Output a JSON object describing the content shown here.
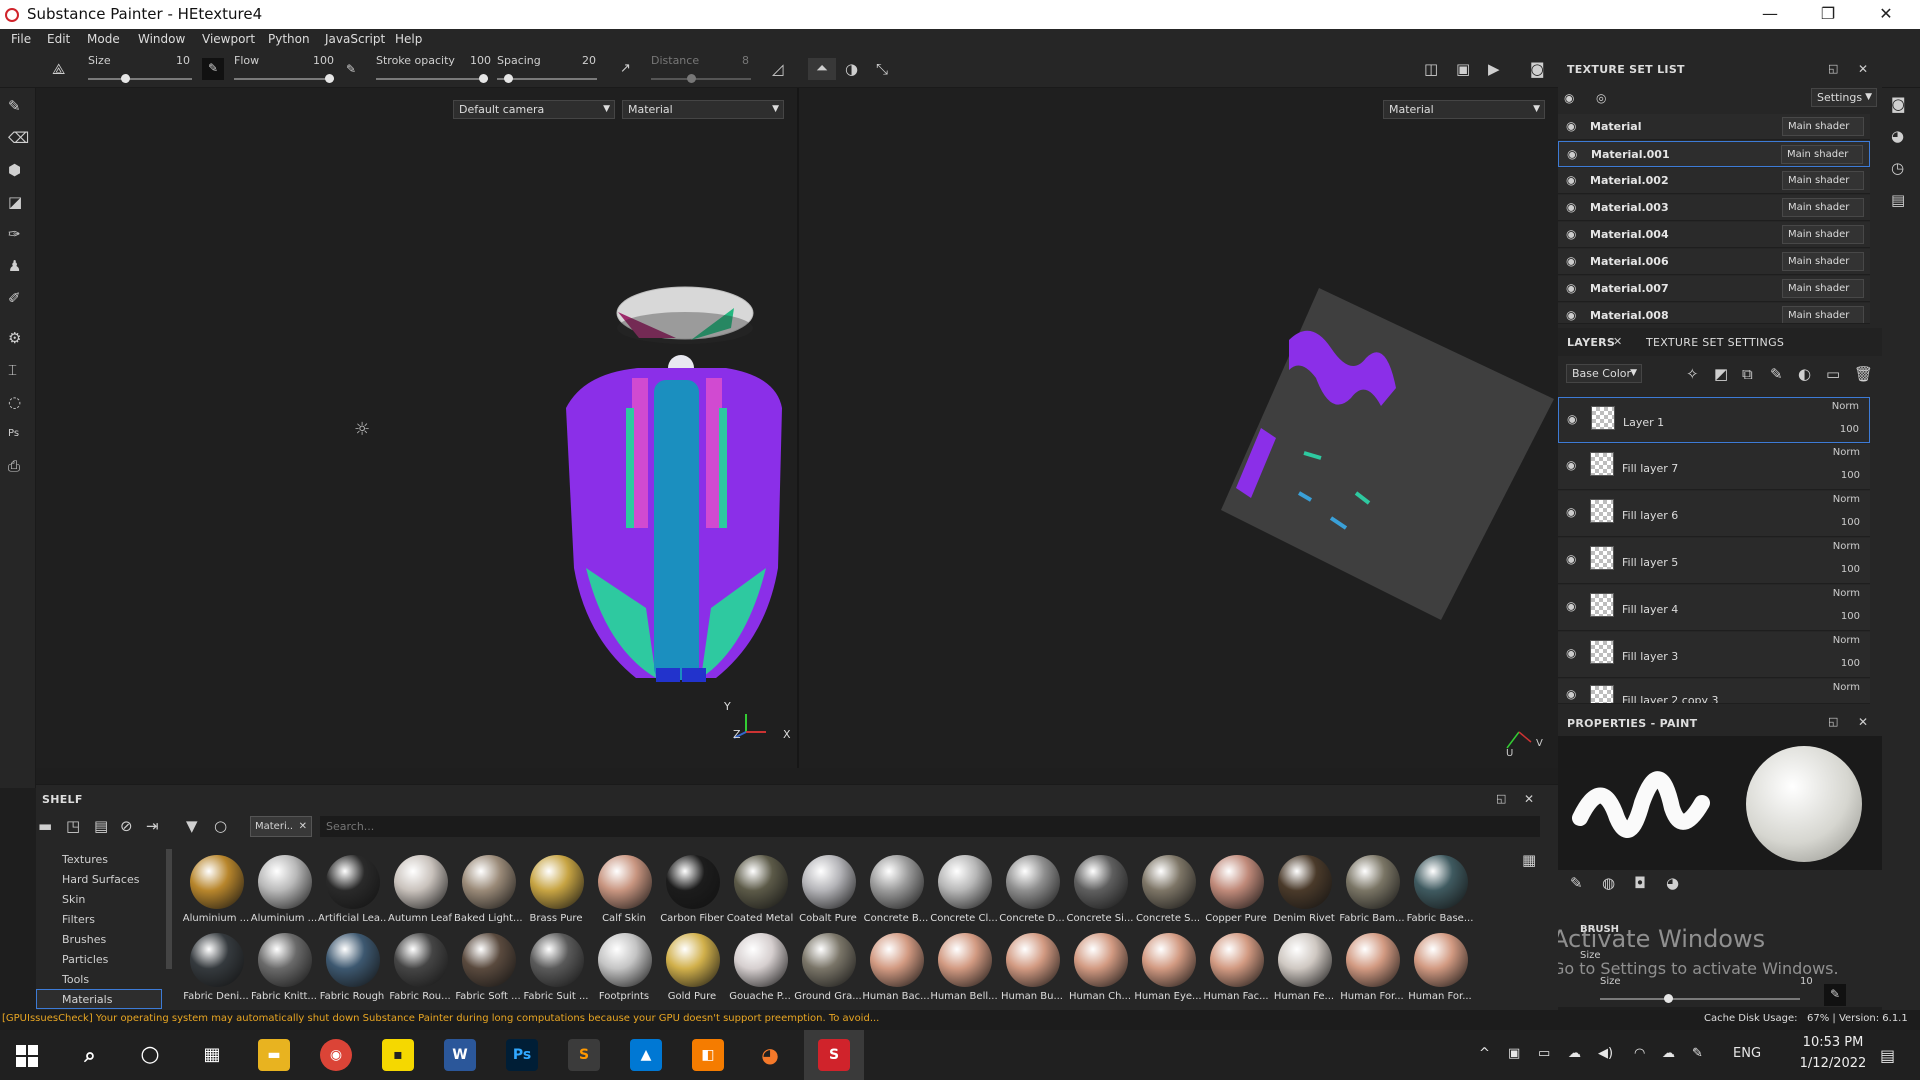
{
  "app": {
    "title": "Substance Painter - HEtexture4"
  },
  "window_controls": {
    "minimize": "—",
    "maximize": "❐",
    "close": "✕"
  },
  "menu": [
    "File",
    "Edit",
    "Mode",
    "Window",
    "Viewport",
    "Python",
    "JavaScript",
    "Help"
  ],
  "toolbar": {
    "size_label": "Size",
    "size_value": "10",
    "size_level": 0.35,
    "flow_label": "Flow",
    "flow_value": "100",
    "flow_level": 1.0,
    "stroke_opacity_label": "Stroke opacity",
    "stroke_opacity_value": "100",
    "stroke_opacity_level": 1.0,
    "spacing_label": "Spacing",
    "spacing_value": "20",
    "spacing_level": 0.08,
    "distance_label": "Distance",
    "distance_value": "8",
    "distance_level": 0.4
  },
  "viewport": {
    "camera_select": "Default camera",
    "left_mode_select": "Material",
    "right_mode_select": "Material",
    "axis_3d": [
      "Y",
      "Z",
      "X"
    ],
    "axis_uv": [
      "U",
      "V"
    ]
  },
  "texture_set_list": {
    "title": "TEXTURE SET LIST",
    "settings_button": "Settings",
    "items": [
      {
        "name": "Material",
        "shader": "Main shader"
      },
      {
        "name": "Material.001",
        "shader": "Main shader",
        "selected": true
      },
      {
        "name": "Material.002",
        "shader": "Main shader"
      },
      {
        "name": "Material.003",
        "shader": "Main shader"
      },
      {
        "name": "Material.004",
        "shader": "Main shader"
      },
      {
        "name": "Material.006",
        "shader": "Main shader"
      },
      {
        "name": "Material.007",
        "shader": "Main shader"
      },
      {
        "name": "Material.008",
        "shader": "Main shader"
      }
    ]
  },
  "layers": {
    "tab_layers": "LAYERS",
    "tab_texture_set_settings": "TEXTURE SET SETTINGS",
    "channel_select": "Base Color",
    "items": [
      {
        "name": "Layer 1",
        "blend": "Norm",
        "opacity": "100",
        "selected": true
      },
      {
        "name": "Fill layer 7",
        "blend": "Norm",
        "opacity": "100"
      },
      {
        "name": "Fill layer 6",
        "blend": "Norm",
        "opacity": "100"
      },
      {
        "name": "Fill layer 5",
        "blend": "Norm",
        "opacity": "100"
      },
      {
        "name": "Fill layer 4",
        "blend": "Norm",
        "opacity": "100"
      },
      {
        "name": "Fill layer 3",
        "blend": "Norm",
        "opacity": "100"
      },
      {
        "name": "Fill layer 2 copy 3",
        "blend": "Norm",
        "opacity": ""
      }
    ]
  },
  "properties": {
    "title": "PROPERTIES - PAINT",
    "brush_label": "BRUSH",
    "size_label": "Size",
    "size_value": "10",
    "activate_windows_1": "Activate Windows",
    "activate_windows_2": "Go to Settings to activate Windows."
  },
  "shelf": {
    "title": "SHELF",
    "filter_tag": "Materi..",
    "search_placeholder": "Search...",
    "categories": [
      {
        "name": "Textures"
      },
      {
        "name": "Hard Surfaces"
      },
      {
        "name": "Skin"
      },
      {
        "name": "Filters"
      },
      {
        "name": "Brushes"
      },
      {
        "name": "Particles"
      },
      {
        "name": "Tools"
      },
      {
        "name": "Materials",
        "selected": true
      }
    ],
    "materials_row1": [
      {
        "name": "Aluminium ...",
        "color": "#b8862c"
      },
      {
        "name": "Aluminium ...",
        "color": "#b9b9b9"
      },
      {
        "name": "Artificial Lea...",
        "color": "#2a2a2a"
      },
      {
        "name": "Autumn Leaf",
        "color": "#c9c2bc"
      },
      {
        "name": "Baked Light...",
        "color": "#9a8a78"
      },
      {
        "name": "Brass Pure",
        "color": "#c7a443"
      },
      {
        "name": "Calf Skin",
        "color": "#c89580"
      },
      {
        "name": "Carbon Fiber",
        "color": "#1c1c1c"
      },
      {
        "name": "Coated Metal",
        "color": "#5c5a48"
      },
      {
        "name": "Cobalt Pure",
        "color": "#b4b4b8"
      },
      {
        "name": "Concrete B...",
        "color": "#9b9b9b"
      },
      {
        "name": "Concrete Cl...",
        "color": "#b7b7b7"
      },
      {
        "name": "Concrete D...",
        "color": "#8f8f8f"
      },
      {
        "name": "Concrete Si...",
        "color": "#5f5f5f"
      },
      {
        "name": "Concrete S...",
        "color": "#7d7566"
      },
      {
        "name": "Copper Pure",
        "color": "#c08a7a"
      },
      {
        "name": "Denim Rivet",
        "color": "#4a3a2a"
      },
      {
        "name": "Fabric Bam...",
        "color": "#7a7565"
      },
      {
        "name": "Fabric Base...",
        "color": "#3f5a60"
      }
    ],
    "materials_row2": [
      {
        "name": "Fabric Deni...",
        "color": "#353a3e"
      },
      {
        "name": "Fabric Knitt...",
        "color": "#6a6a6a"
      },
      {
        "name": "Fabric Rough",
        "color": "#3d5870"
      },
      {
        "name": "Fabric Rou...",
        "color": "#454545"
      },
      {
        "name": "Fabric Soft ...",
        "color": "#5a4a3e"
      },
      {
        "name": "Fabric Suit ...",
        "color": "#5a5a5a"
      },
      {
        "name": "Footprints",
        "color": "#c4c4c4"
      },
      {
        "name": "Gold Pure",
        "color": "#d1b04b"
      },
      {
        "name": "Gouache P...",
        "color": "#d6cfcf"
      },
      {
        "name": "Ground Gra...",
        "color": "#7a7568"
      },
      {
        "name": "Human Bac...",
        "color": "#d29a82"
      },
      {
        "name": "Human Bell...",
        "color": "#d29a82"
      },
      {
        "name": "Human Bu...",
        "color": "#d29a82"
      },
      {
        "name": "Human Ch...",
        "color": "#d29a82"
      },
      {
        "name": "Human Eye...",
        "color": "#d29a82"
      },
      {
        "name": "Human Fac...",
        "color": "#d29a82"
      },
      {
        "name": "Human Fe...",
        "color": "#cfc8c2"
      },
      {
        "name": "Human For...",
        "color": "#d29a82"
      },
      {
        "name": "Human For...",
        "color": "#d29a82"
      }
    ]
  },
  "statusbar": {
    "message": "[GPUIssuesCheck] Your operating system may automatically shut down Substance Painter during long computations because your GPU doesn't support preemption. To avoid...",
    "cache": "Cache Disk Usage:",
    "cache_value": "67% | Version: 6.1.1"
  },
  "taskbar": {
    "apps": [
      "Chrome",
      "Sticky Notes",
      "Word",
      "Ps",
      "Sublime",
      "Photos",
      "PDF",
      "Blender",
      "Substance Painter"
    ],
    "lang": "ENG",
    "time": "10:53 PM",
    "date": "1/12/2022"
  }
}
